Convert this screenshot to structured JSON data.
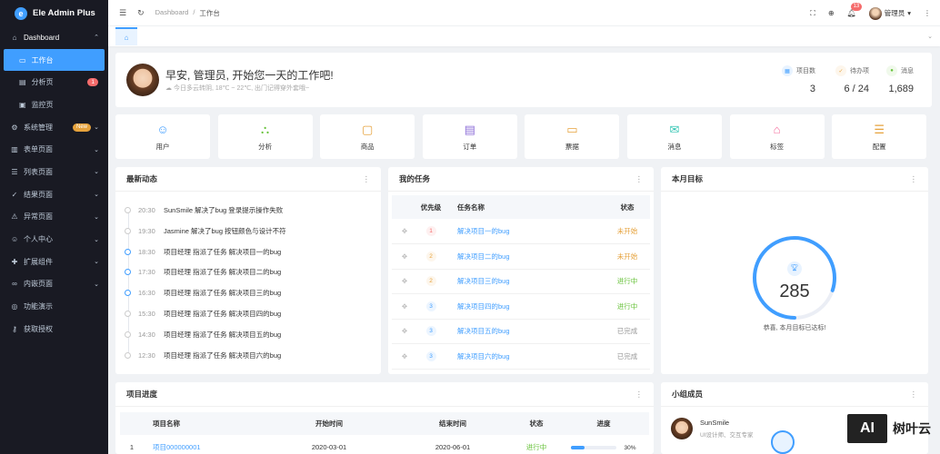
{
  "app": {
    "title": "Ele Admin Plus",
    "logo_letter": "e"
  },
  "sidebar": {
    "items": [
      {
        "label": "Dashboard",
        "icon": "home-icon",
        "open": true
      },
      {
        "label": "工作台",
        "icon": "monitor-icon",
        "active": true,
        "sub": true
      },
      {
        "label": "分析页",
        "icon": "chart-icon",
        "badge": "1",
        "sub": true
      },
      {
        "label": "监控页",
        "icon": "screen-icon",
        "sub": true
      },
      {
        "label": "系统管理",
        "icon": "gear-icon",
        "badge_new": "New"
      },
      {
        "label": "表单页面",
        "icon": "form-icon"
      },
      {
        "label": "列表页面",
        "icon": "list-icon"
      },
      {
        "label": "结果页面",
        "icon": "check-icon"
      },
      {
        "label": "异常页面",
        "icon": "warning-icon"
      },
      {
        "label": "个人中心",
        "icon": "user-icon"
      },
      {
        "label": "扩展组件",
        "icon": "puzzle-icon"
      },
      {
        "label": "内嵌页面",
        "icon": "link-icon"
      },
      {
        "label": "功能演示",
        "icon": "compass-icon"
      },
      {
        "label": "获取授权",
        "icon": "key-icon"
      }
    ]
  },
  "header": {
    "breadcrumb": [
      "Dashboard",
      "工作台"
    ],
    "bell_count": "13",
    "username": "管理员"
  },
  "welcome": {
    "greeting": "早安, 管理员, 开始您一天的工作吧!",
    "weather": "今日多云转阴, 18℃ ~ 22℃, 出门记得穿外套哦~",
    "stats": [
      {
        "label": "项目数",
        "value": "3",
        "color": "#409eff"
      },
      {
        "label": "待办项",
        "value": "6 / 24",
        "color": "#e6a23c"
      },
      {
        "label": "消息",
        "value": "1,689",
        "color": "#67c23a"
      }
    ]
  },
  "shortcuts": [
    {
      "label": "用户",
      "icon": "user-icon",
      "color": "#409eff"
    },
    {
      "label": "分析",
      "icon": "analysis-icon",
      "color": "#67c23a"
    },
    {
      "label": "商品",
      "icon": "bag-icon",
      "color": "#e6a23c"
    },
    {
      "label": "订单",
      "icon": "order-icon",
      "color": "#8e6fd8"
    },
    {
      "label": "票据",
      "icon": "ticket-icon",
      "color": "#e6a23c"
    },
    {
      "label": "消息",
      "icon": "mail-icon",
      "color": "#36c6b4"
    },
    {
      "label": "标签",
      "icon": "tag-icon",
      "color": "#f56c9c"
    },
    {
      "label": "配置",
      "icon": "config-icon",
      "color": "#e6a23c"
    }
  ],
  "activity": {
    "title": "最新动态",
    "rows": [
      {
        "time": "20:30",
        "text": "SunSmile 解决了bug 登录提示操作失败",
        "blue": false
      },
      {
        "time": "19:30",
        "text": "Jasmine 解决了bug 按钮颜色与设计不符",
        "blue": false
      },
      {
        "time": "18:30",
        "text": "项目经理 指派了任务 解决项目一的bug",
        "blue": true
      },
      {
        "time": "17:30",
        "text": "项目经理 指派了任务 解决项目二的bug",
        "blue": true
      },
      {
        "time": "16:30",
        "text": "项目经理 指派了任务 解决项目三的bug",
        "blue": true
      },
      {
        "time": "15:30",
        "text": "项目经理 指派了任务 解决项目四的bug",
        "blue": false
      },
      {
        "time": "14:30",
        "text": "项目经理 指派了任务 解决项目五的bug",
        "blue": false
      },
      {
        "time": "12:30",
        "text": "项目经理 指派了任务 解决项目六的bug",
        "blue": false
      }
    ]
  },
  "tasks": {
    "title": "我的任务",
    "headers": [
      "优先级",
      "任务名称",
      "状态"
    ],
    "rows": [
      {
        "priority": "1",
        "name": "解决项目一的bug",
        "status": "未开始",
        "status_color": "#e6a23c"
      },
      {
        "priority": "2",
        "name": "解决项目二的bug",
        "status": "未开始",
        "status_color": "#e6a23c"
      },
      {
        "priority": "2",
        "name": "解决项目三的bug",
        "status": "进行中",
        "status_color": "#67c23a"
      },
      {
        "priority": "3",
        "name": "解决项目四的bug",
        "status": "进行中",
        "status_color": "#67c23a"
      },
      {
        "priority": "3",
        "name": "解决项目五的bug",
        "status": "已完成",
        "status_color": "#999999"
      },
      {
        "priority": "3",
        "name": "解决项目六的bug",
        "status": "已完成",
        "status_color": "#999999"
      }
    ]
  },
  "goal": {
    "title": "本月目标",
    "value": "285",
    "progress": 0.8,
    "text": "恭喜, 本月目标已达标!"
  },
  "projects": {
    "title": "项目进度",
    "headers": [
      "项目名称",
      "开始时间",
      "结束时间",
      "状态",
      "进度"
    ],
    "rows": [
      {
        "index": "1",
        "name": "项目000000001",
        "start": "2020-03-01",
        "end": "2020-06-01",
        "status": "进行中",
        "progress": 30,
        "progress_label": "30%"
      }
    ]
  },
  "team": {
    "title": "小组成员",
    "members": [
      {
        "name": "SunSmile",
        "role": "UI设计师、交互专家"
      }
    ]
  },
  "watermark": {
    "box": "AI",
    "text": "树叶云"
  }
}
